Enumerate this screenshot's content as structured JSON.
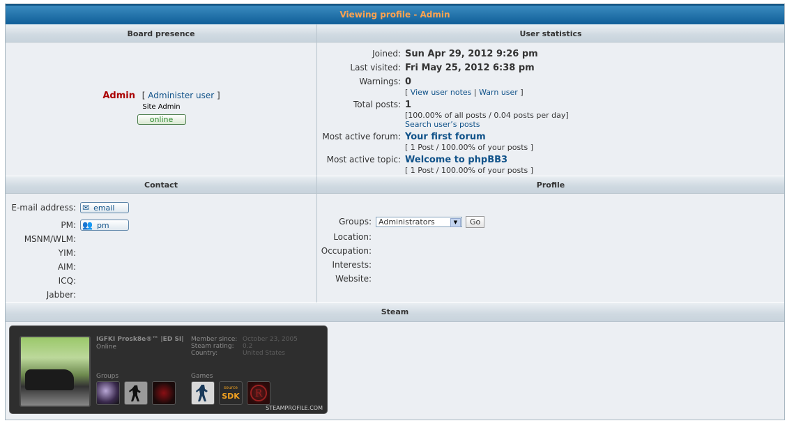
{
  "title": "Viewing profile - Admin",
  "sections": {
    "board_presence": "Board presence",
    "user_statistics": "User statistics",
    "contact": "Contact",
    "profile": "Profile",
    "steam": "Steam"
  },
  "presence": {
    "username": "Admin",
    "bracket_open": "[",
    "administer_link": "Administer user",
    "bracket_close": "]",
    "rank": "Site Admin",
    "online_label": "online"
  },
  "stats": {
    "joined_label": "Joined:",
    "joined_value": "Sun Apr 29, 2012 9:26 pm",
    "last_visited_label": "Last visited:",
    "last_visited_value": "Fri May 25, 2012 6:38 pm",
    "warnings_label": "Warnings:",
    "warnings_value": "0",
    "view_notes_link": "View user notes",
    "warn_user_link": "Warn user",
    "total_posts_label": "Total posts:",
    "total_posts_value": "1",
    "total_posts_detail": "[100.00% of all posts / 0.04 posts per day]",
    "search_posts_link": "Search user’s posts",
    "active_forum_label": "Most active forum:",
    "active_forum_value": "Your first forum",
    "active_forum_detail": "[ 1 Post / 100.00% of your posts ]",
    "active_topic_label": "Most active topic:",
    "active_topic_value": "Welcome to phpBB3",
    "active_topic_detail": "[ 1 Post / 100.00% of your posts ]"
  },
  "contact": {
    "email_label": "E-mail address:",
    "email_button": "email",
    "pm_label": "PM:",
    "pm_button": "pm",
    "msnm_label": "MSNM/WLM:",
    "yim_label": "YIM:",
    "aim_label": "AIM:",
    "icq_label": "ICQ:",
    "jabber_label": "Jabber:"
  },
  "profile": {
    "groups_label": "Groups:",
    "groups_selected": "Administrators",
    "go_button": "Go",
    "location_label": "Location:",
    "occupation_label": "Occupation:",
    "interests_label": "Interests:",
    "website_label": "Website:"
  },
  "steam_card": {
    "name": "IGFKI Prosk8e®™ |ED SI|",
    "status": "Online",
    "member_since_label": "Member since:",
    "member_since_value": "October 23, 2005",
    "rating_label": "Steam rating:",
    "rating_value": "0.2",
    "country_label": "Country:",
    "country_value": "United States",
    "groups_label": "Groups",
    "games_label": "Games",
    "footer": "STEAMPROFILE.COM",
    "group_icons": [
      "group-dark-logo-icon",
      "counter-strike-group-icon",
      "red-spider-group-icon"
    ],
    "game_icons": [
      "counter-strike-game-icon",
      "source-sdk-icon",
      "red-emblem-game-icon"
    ]
  },
  "colors": {
    "title_text": "#ffa34f",
    "title_bar": "#0f5e98",
    "username": "#aa0000",
    "link": "#105289",
    "online": "#2c8a2c"
  }
}
